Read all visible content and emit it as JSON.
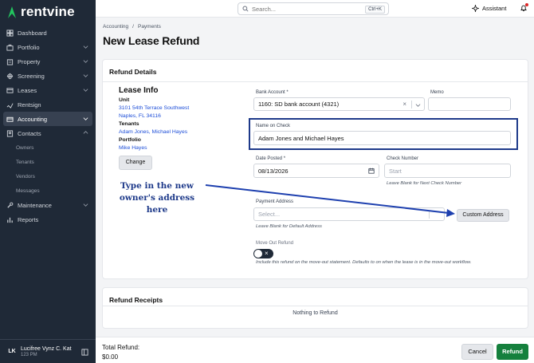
{
  "app": {
    "name": "rentvine",
    "brand_color": "#22c55e"
  },
  "sidebar": {
    "items": [
      {
        "label": "Dashboard",
        "icon": "dashboard-icon"
      },
      {
        "label": "Portfolio",
        "icon": "portfolio-icon"
      },
      {
        "label": "Property",
        "icon": "property-icon"
      },
      {
        "label": "Screening",
        "icon": "screening-icon"
      },
      {
        "label": "Leases",
        "icon": "leases-icon"
      },
      {
        "label": "Rentsign",
        "icon": "rentsign-icon"
      },
      {
        "label": "Accounting",
        "icon": "accounting-icon"
      },
      {
        "label": "Contacts",
        "icon": "contacts-icon"
      },
      {
        "label": "Maintenance",
        "icon": "maintenance-icon"
      },
      {
        "label": "Reports",
        "icon": "reports-icon"
      }
    ],
    "contacts_sub": [
      "Owners",
      "Tenants",
      "Vendors",
      "Messages"
    ],
    "user": {
      "initials": "LK",
      "name": "Lucifree Vynz C. Kat",
      "role": "123 PM"
    }
  },
  "topbar": {
    "search_placeholder": "Search...",
    "search_shortcut": "Ctrl+K",
    "assistant_label": "Assistant"
  },
  "breadcrumb": {
    "root": "Accounting",
    "sep": "/",
    "current": "Payments"
  },
  "page_title": "New Lease Refund",
  "refund_details": {
    "title": "Refund Details",
    "lease_info": {
      "heading": "Lease Info",
      "unit_label": "Unit",
      "unit_line1": "3101 54th Terrace Southwest",
      "unit_line2": "Naples, FL 34116",
      "tenants_label": "Tenants",
      "tenants": "Adam Jones, Michael Hayes",
      "portfolio_label": "Portfolio",
      "portfolio": "Mike Hayes",
      "change_label": "Change"
    },
    "bank_account": {
      "label": "Bank Account *",
      "value": "1160: SD bank account (4321)"
    },
    "memo": {
      "label": "Memo",
      "value": ""
    },
    "name_on_check": {
      "label": "Name on Check",
      "value": "Adam Jones and Michael Hayes"
    },
    "date_posted": {
      "label": "Date Posted *",
      "value": "08/13/2026"
    },
    "check_number": {
      "label": "Check Number",
      "placeholder": "Start",
      "hint": "Leave Blank for Next Check Number"
    },
    "payment_address": {
      "label": "Payment Address",
      "placeholder": "Select...",
      "hint": "Leave Blank for Default Address"
    },
    "custom_address_label": "Custom Address",
    "move_out": {
      "label": "Move Out Refund",
      "on": false,
      "hint": "Include this refund on the move-out statement. Defaults to on when the lease is in the move-out workflow."
    }
  },
  "annotation": {
    "text": "Type in the new owner's address here",
    "color": "#1e3a8a"
  },
  "refund_receipts": {
    "title": "Refund Receipts",
    "empty_text": "Nothing to Refund"
  },
  "footer": {
    "total_label": "Total Refund:",
    "total_value": "$0.00",
    "cancel_label": "Cancel",
    "refund_label": "Refund",
    "refund_color": "#15803d"
  }
}
